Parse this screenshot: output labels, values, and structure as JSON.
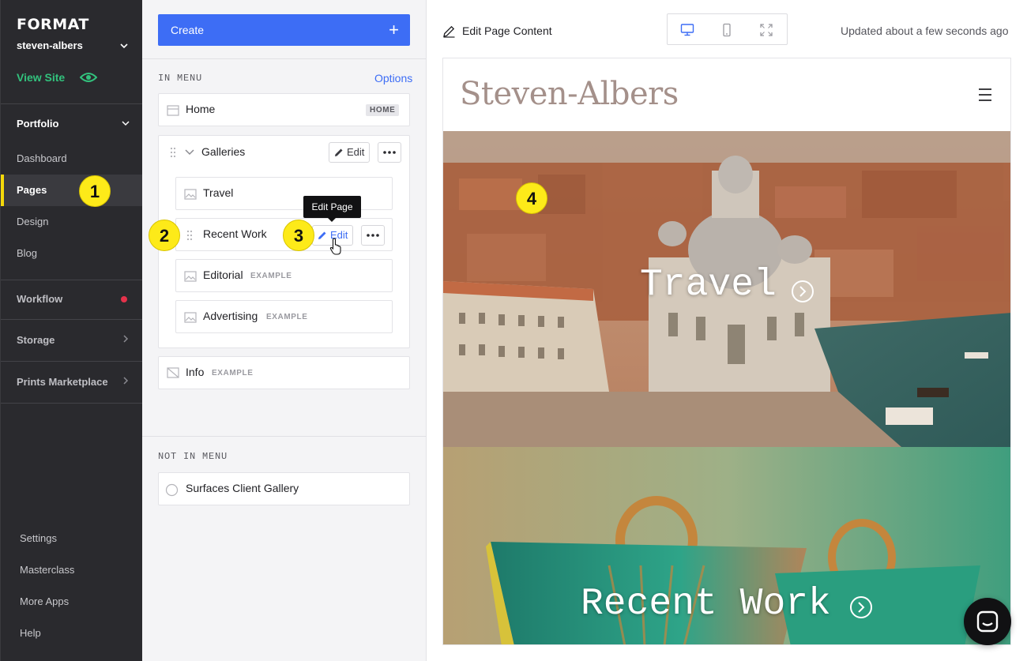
{
  "sidebar": {
    "logo": "FORMAT",
    "site_name": "steven-albers",
    "view_site": "View Site",
    "sections": {
      "portfolio": "Portfolio",
      "workflow": "Workflow",
      "storage": "Storage",
      "prints": "Prints Marketplace"
    },
    "items": [
      {
        "label": "Dashboard"
      },
      {
        "label": "Pages",
        "active": true
      },
      {
        "label": "Design"
      },
      {
        "label": "Blog"
      }
    ],
    "bottom_items": [
      {
        "label": "Settings"
      },
      {
        "label": "Masterclass"
      },
      {
        "label": "More Apps"
      },
      {
        "label": "Help"
      }
    ],
    "colors": {
      "accent_green": "#32c27d",
      "active_marker": "#f5d90a",
      "notification": "#e5324b"
    }
  },
  "pages_panel": {
    "create_label": "Create",
    "create_icon": "plus-icon",
    "in_menu_label": "IN MENU",
    "options_label": "Options",
    "home": {
      "label": "Home",
      "tag": "HOME"
    },
    "galleries": {
      "label": "Galleries",
      "edit_label": "Edit",
      "children": [
        {
          "label": "Travel",
          "tag": ""
        },
        {
          "label": "Recent Work",
          "tag": ""
        },
        {
          "label": "Editorial",
          "tag": "EXAMPLE"
        },
        {
          "label": "Advertising",
          "tag": "EXAMPLE"
        }
      ]
    },
    "recent_work_edit_label": "Edit",
    "tooltip": "Edit Page",
    "info": {
      "label": "Info",
      "tag": "EXAMPLE"
    },
    "not_in_menu_label": "NOT IN MENU",
    "not_in_menu_items": [
      {
        "label": "Surfaces Client Gallery"
      }
    ],
    "accent": "#3d6df5"
  },
  "preview": {
    "edit_content_label": "Edit Page Content",
    "device_modes": [
      "desktop-icon",
      "mobile-icon",
      "fullscreen-icon"
    ],
    "active_device": "desktop-icon",
    "updated_text": "Updated about a few seconds ago",
    "site_title": "Steven-Albers",
    "sections": [
      {
        "label": "Travel"
      },
      {
        "label": "Recent Work"
      }
    ]
  },
  "annotations": {
    "badges": [
      "1",
      "2",
      "3",
      "4"
    ],
    "color": "#fdea19"
  }
}
